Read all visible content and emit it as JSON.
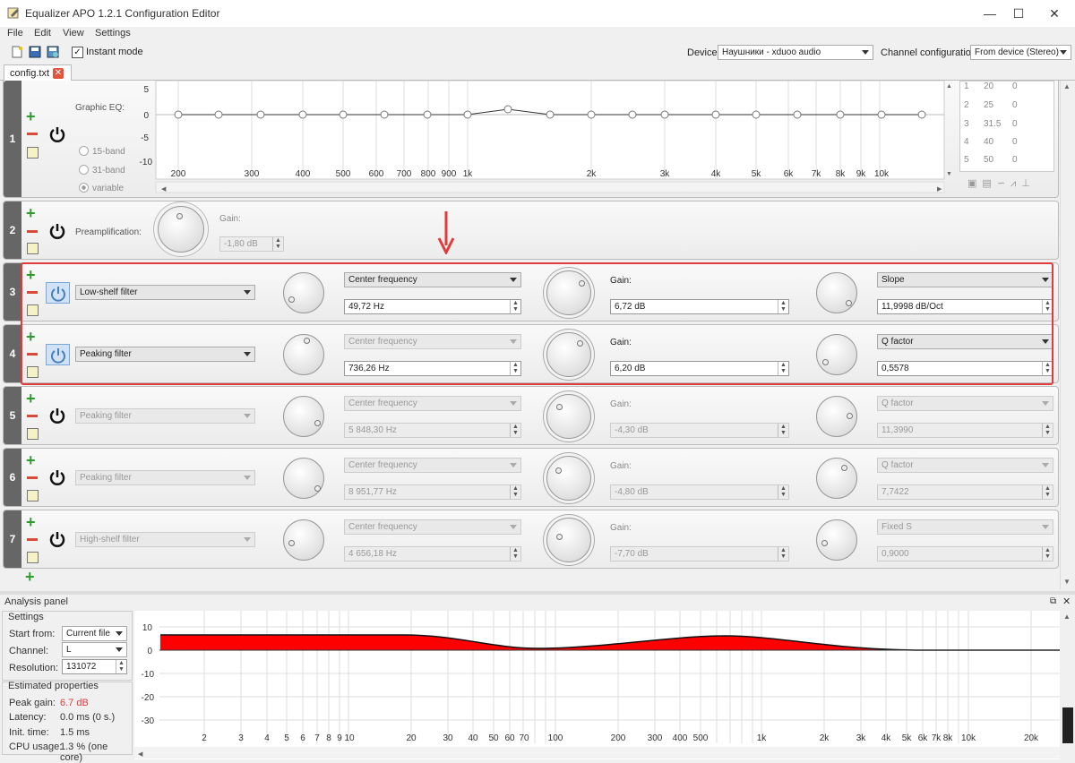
{
  "window": {
    "title": "Equalizer APO 1.2.1 Configuration Editor",
    "minimize": "—",
    "maximize": "☐",
    "close": "✕"
  },
  "menu": [
    "File",
    "Edit",
    "View",
    "Settings"
  ],
  "toolbar": {
    "instant_mode": "Instant mode",
    "device_label": "Device:",
    "device_value": "Наушники - xduoo audio",
    "channel_label": "Channel configuration:",
    "channel_value": "From device (Stereo)"
  },
  "tab": {
    "name": "config.txt",
    "close": "✕"
  },
  "rows": [
    {
      "num": "1",
      "graphic_eq_label": "Graphic EQ:",
      "bands": [
        "15-band",
        "31-band",
        "variable"
      ],
      "y_ticks": [
        "5",
        "0",
        "-5",
        "-10"
      ],
      "x_ticks": [
        "200",
        "300",
        "400",
        "500",
        "600",
        "700",
        "800",
        "900",
        "1k",
        "2k",
        "3k",
        "4k",
        "5k",
        "6k",
        "7k",
        "8k",
        "9k",
        "10k"
      ],
      "table": [
        [
          "1",
          "20",
          "0"
        ],
        [
          "2",
          "25",
          "0"
        ],
        [
          "3",
          "31.5",
          "0"
        ],
        [
          "4",
          "40",
          "0"
        ],
        [
          "5",
          "50",
          "0"
        ]
      ]
    },
    {
      "num": "2",
      "preamp_label": "Preamplification:",
      "gain_label": "Gain:",
      "gain_value": "-1,80 dB"
    },
    {
      "num": "3",
      "filter": "Low-shelf filter",
      "param1": "Center frequency",
      "param1_value": "49,72 Hz",
      "gain_label": "Gain:",
      "gain_value": "6,72 dB",
      "param3": "Slope",
      "param3_value": "11,9998 dB/Oct"
    },
    {
      "num": "4",
      "filter": "Peaking filter",
      "param1": "Center frequency",
      "param1_value": "736,26 Hz",
      "gain_label": "Gain:",
      "gain_value": "6,20 dB",
      "param3": "Q factor",
      "param3_value": "0,5578"
    },
    {
      "num": "5",
      "filter": "Peaking filter",
      "param1": "Center frequency",
      "param1_value": "5 848,30 Hz",
      "gain_label": "Gain:",
      "gain_value": "-4,30 dB",
      "param3": "Q factor",
      "param3_value": "11,3990"
    },
    {
      "num": "6",
      "filter": "Peaking filter",
      "param1": "Center frequency",
      "param1_value": "8 951,77 Hz",
      "gain_label": "Gain:",
      "gain_value": "-4,80 dB",
      "param3": "Q factor",
      "param3_value": "7,7422"
    },
    {
      "num": "7",
      "filter": "High-shelf filter",
      "param1": "Center frequency",
      "param1_value": "4 656,18 Hz",
      "gain_label": "Gain:",
      "gain_value": "-7,70 dB",
      "param3": "Fixed S",
      "param3_value": "0,9000"
    }
  ],
  "analysis": {
    "title": "Analysis panel",
    "settings_title": "Settings",
    "start_from_label": "Start from:",
    "start_from_value": "Current file",
    "channel_label": "Channel:",
    "channel_value": "L",
    "resolution_label": "Resolution:",
    "resolution_value": "131072",
    "estimated_title": "Estimated properties",
    "peak_gain_label": "Peak gain:",
    "peak_gain_value": "6.7 dB",
    "latency_label": "Latency:",
    "latency_value": "0.0 ms (0 s.)",
    "init_label": "Init. time:",
    "init_value": "1.5 ms",
    "cpu_label": "CPU usage:",
    "cpu_value": "1.3 % (one core)",
    "y_ticks": [
      "10",
      "0",
      "-10",
      "-20",
      "-30"
    ],
    "x_ticks": [
      "2",
      "3",
      "4",
      "5",
      "6",
      "7",
      "8",
      "9",
      "10",
      "20",
      "30",
      "40",
      "50",
      "60",
      "70",
      "100",
      "200",
      "300",
      "400",
      "500",
      "1k",
      "2k",
      "3k",
      "4k",
      "5k",
      "6k",
      "7k",
      "8k",
      "10k",
      "20k"
    ]
  },
  "colors": {
    "accent_red": "#e03c3c",
    "fill": "#ff0000",
    "plus": "#2e9d2e"
  }
}
